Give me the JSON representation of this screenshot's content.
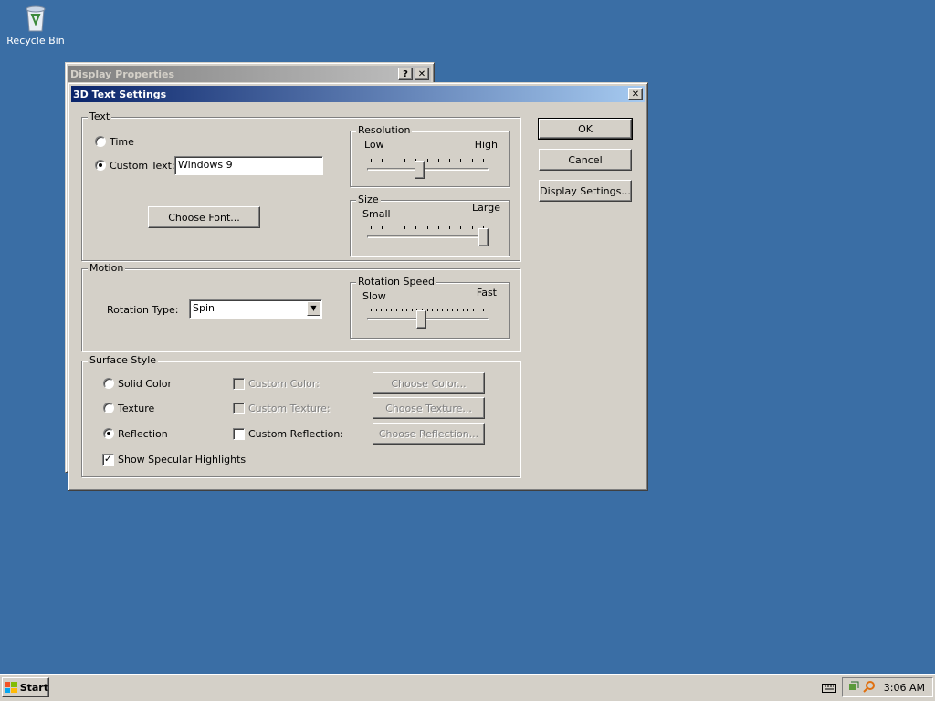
{
  "desktop": {
    "recycle_bin_label": "Recycle Bin",
    "icon": "recycle-bin-icon"
  },
  "display_properties": {
    "title": "Display Properties",
    "help_btn": "?",
    "close_btn": "✕"
  },
  "dialog": {
    "title": "3D Text Settings",
    "close_btn": "✕",
    "buttons": {
      "ok": "OK",
      "cancel": "Cancel",
      "display_settings": "Display Settings..."
    },
    "text_group": {
      "legend": "Text",
      "time_label": "Time",
      "custom_text_label": "Custom Text:",
      "custom_text_value": "Windows 9",
      "choose_font": "Choose Font...",
      "selected": "custom_text"
    },
    "resolution": {
      "legend": "Resolution",
      "low": "Low",
      "high": "High",
      "level": 0.43
    },
    "size": {
      "legend": "Size",
      "small": "Small",
      "large": "Large",
      "level": 1.0
    },
    "motion": {
      "legend": "Motion",
      "rotation_type_label": "Rotation Type:",
      "rotation_type_value": "Spin",
      "rotation_speed": {
        "legend": "Rotation Speed",
        "slow": "Slow",
        "fast": "Fast",
        "level": 0.44
      }
    },
    "surface": {
      "legend": "Surface Style",
      "solid_color": "Solid Color",
      "texture": "Texture",
      "reflection": "Reflection",
      "selected": "reflection",
      "custom_color": "Custom Color:",
      "custom_texture": "Custom Texture:",
      "custom_reflection": "Custom Reflection:",
      "choose_color": "Choose Color...",
      "choose_texture": "Choose Texture...",
      "choose_reflection": "Choose Reflection...",
      "show_specular": "Show Specular Highlights",
      "show_specular_checked": true
    }
  },
  "taskbar": {
    "start_label": "Start",
    "clock": "3:06 AM"
  },
  "colors": {
    "desktop": "#3a6ea5",
    "face": "#d4d0c8",
    "active_title": "#0a246a"
  }
}
